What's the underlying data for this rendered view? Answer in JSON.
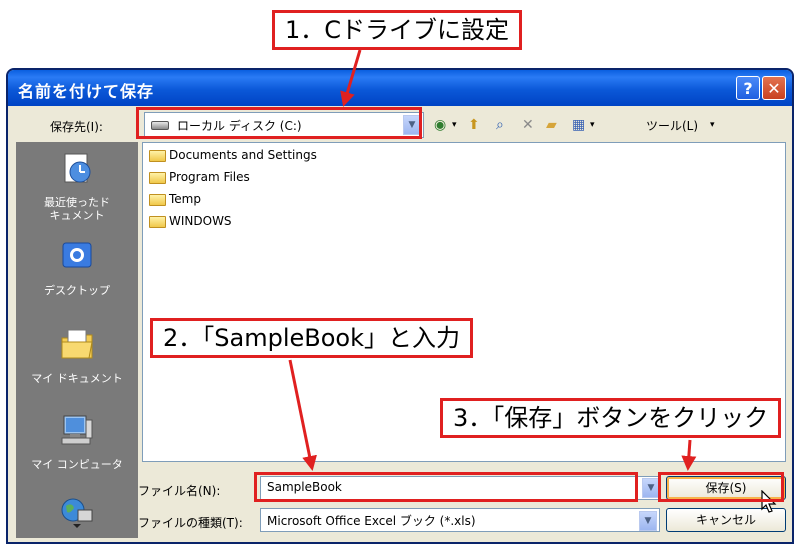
{
  "dialog": {
    "title": "名前を付けて保存",
    "help_label": "?",
    "close_label": "✕"
  },
  "location": {
    "label": "保存先(I):",
    "value": "ローカル ディスク (C:)"
  },
  "toolbar": {
    "tools_label": "ツール(L)",
    "icons": [
      "back-icon",
      "up-folder-icon",
      "search-web-icon",
      "delete-icon",
      "new-folder-icon",
      "views-icon"
    ]
  },
  "places": [
    {
      "label": "最近使ったド\nキュメント",
      "icon": "recent-documents-icon"
    },
    {
      "label": "デスクトップ",
      "icon": "desktop-icon"
    },
    {
      "label": "マイ ドキュメント",
      "icon": "my-documents-icon"
    },
    {
      "label": "マイ コンピュータ",
      "icon": "my-computer-icon"
    },
    {
      "label": "",
      "icon": "network-icon"
    }
  ],
  "files": [
    "Documents and Settings",
    "Program Files",
    "Temp",
    "WINDOWS"
  ],
  "filename": {
    "label": "ファイル名(N):",
    "value": "SampleBook"
  },
  "filetype": {
    "label": "ファイルの種類(T):",
    "value": "Microsoft Office Excel ブック (*.xls)"
  },
  "buttons": {
    "save": "保存(S)",
    "cancel": "キャンセル"
  },
  "annotations": {
    "step1": "1．Cドライブに設定",
    "step2": "2．「SampleBook」と入力",
    "step3": "3．「保存」ボタンをクリック"
  },
  "colors": {
    "annotation": "#e02020",
    "titlebar": "#0a5fe0"
  }
}
